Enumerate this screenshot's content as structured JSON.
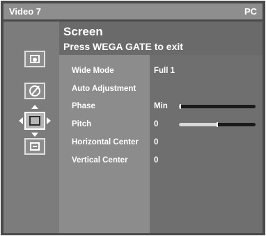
{
  "header": {
    "input_name": "Video 7",
    "mode": "PC"
  },
  "title": {
    "heading": "Screen",
    "hint": "Press WEGA GATE to exit"
  },
  "menu_icons": [
    "picture-icon",
    "sound-icon",
    "screen-icon",
    "setup-icon"
  ],
  "settings": [
    {
      "label": "Wide Mode",
      "value": "Full 1"
    },
    {
      "label": "Auto Adjustment",
      "value": ""
    },
    {
      "label": "Phase",
      "value": "Min",
      "level": 0.02
    },
    {
      "label": "Pitch",
      "value": "0",
      "level": 0.5
    },
    {
      "label": "Horizontal Center",
      "value": "0"
    },
    {
      "label": "Vertical Center",
      "value": "0"
    }
  ],
  "colors": {
    "background": "#4a4a4a",
    "header": "#8e8e8e",
    "label_panel": "#8c8c8c",
    "value_panel": "#6f6f6f",
    "text": "#ffffff"
  }
}
